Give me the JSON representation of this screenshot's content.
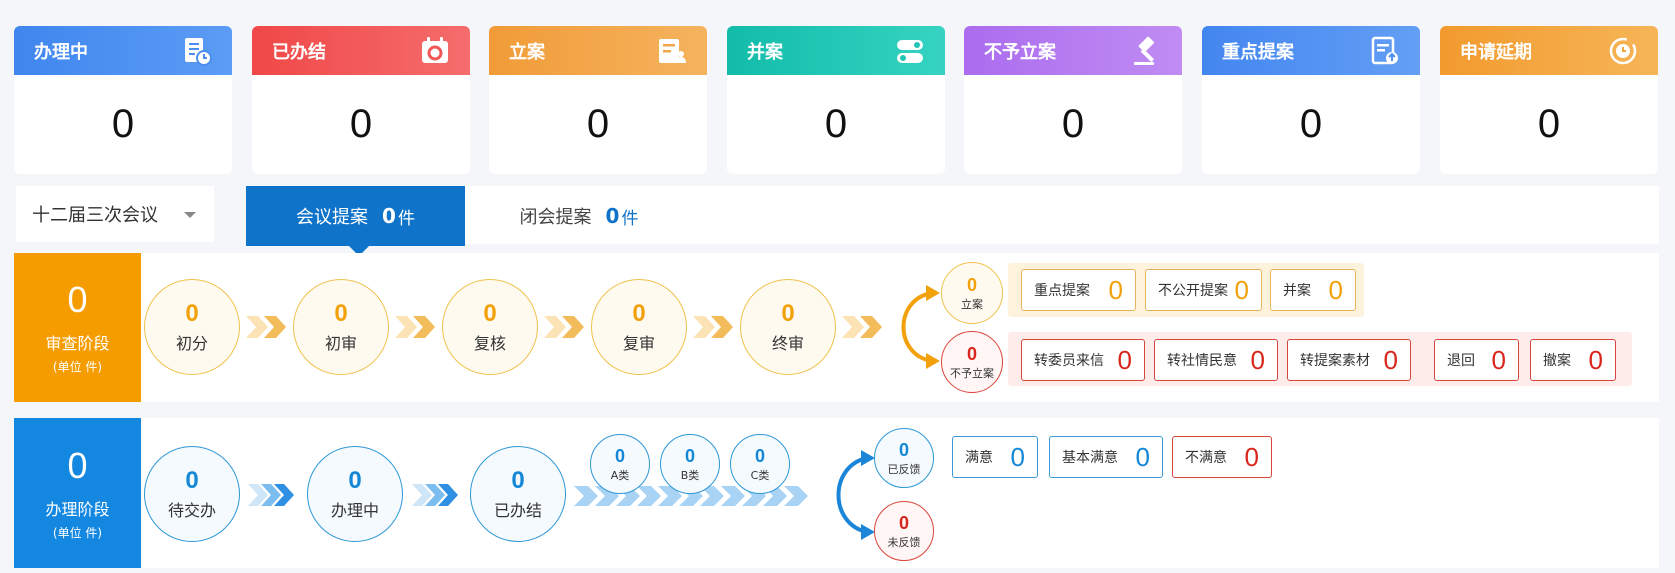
{
  "stats": [
    {
      "label": "办理中",
      "value": "0",
      "color": "#4a8ef0",
      "icon": "document-clock-icon"
    },
    {
      "label": "已办结",
      "value": "0",
      "color": "#f25757",
      "icon": "calendar-icon"
    },
    {
      "label": "立案",
      "value": "0",
      "color": "#f3a74a",
      "icon": "list-person-icon"
    },
    {
      "label": "并案",
      "value": "0",
      "color": "#23c6b5",
      "icon": "merge-toggle-icon"
    },
    {
      "label": "不予立案",
      "value": "0",
      "color": "#b378ef",
      "icon": "gavel-icon"
    },
    {
      "label": "重点提案",
      "value": "0",
      "color": "#4f8ff2",
      "icon": "document-upload-icon"
    },
    {
      "label": "申请延期",
      "value": "0",
      "color": "#f4a73b",
      "icon": "clock-circle-icon"
    }
  ],
  "meeting": {
    "selected": "十二届三次会议"
  },
  "tabs": [
    {
      "label": "会议提案",
      "count": "0",
      "unit": "件",
      "active": true
    },
    {
      "label": "闭会提案",
      "count": "0",
      "unit": "件",
      "active": false
    }
  ],
  "review": {
    "color": "#f59c00",
    "total": "0",
    "label": "审查阶段",
    "unit_label": "(单位 件)",
    "steps": [
      {
        "label": "初分",
        "value": "0"
      },
      {
        "label": "初审",
        "value": "0"
      },
      {
        "label": "复核",
        "value": "0"
      },
      {
        "label": "复审",
        "value": "0"
      },
      {
        "label": "终审",
        "value": "0"
      }
    ],
    "accepted": {
      "label": "立案",
      "value": "0"
    },
    "rejected": {
      "label": "不予立案",
      "value": "0"
    },
    "accepted_tags": [
      {
        "label": "重点提案",
        "value": "0"
      },
      {
        "label": "不公开提案",
        "value": "0"
      },
      {
        "label": "并案",
        "value": "0"
      }
    ],
    "rejected_tags": [
      {
        "label": "转委员来信",
        "value": "0"
      },
      {
        "label": "转社情民意",
        "value": "0"
      },
      {
        "label": "转提案素材",
        "value": "0"
      },
      {
        "label": "退回",
        "value": "0"
      },
      {
        "label": "撤案",
        "value": "0"
      }
    ]
  },
  "handling": {
    "color": "#1488e0",
    "total": "0",
    "label": "办理阶段",
    "unit_label": "(单位 件)",
    "steps": [
      {
        "label": "待交办",
        "value": "0"
      },
      {
        "label": "办理中",
        "value": "0"
      },
      {
        "label": "已办结",
        "value": "0"
      }
    ],
    "categories": [
      {
        "label": "A类",
        "value": "0"
      },
      {
        "label": "B类",
        "value": "0"
      },
      {
        "label": "C类",
        "value": "0"
      }
    ],
    "feedback": {
      "label": "已反馈",
      "value": "0"
    },
    "no_feedback": {
      "label": "未反馈",
      "value": "0"
    },
    "feedback_tags": [
      {
        "label": "满意",
        "value": "0"
      },
      {
        "label": "基本满意",
        "value": "0"
      },
      {
        "label": "不满意",
        "value": "0"
      }
    ]
  }
}
